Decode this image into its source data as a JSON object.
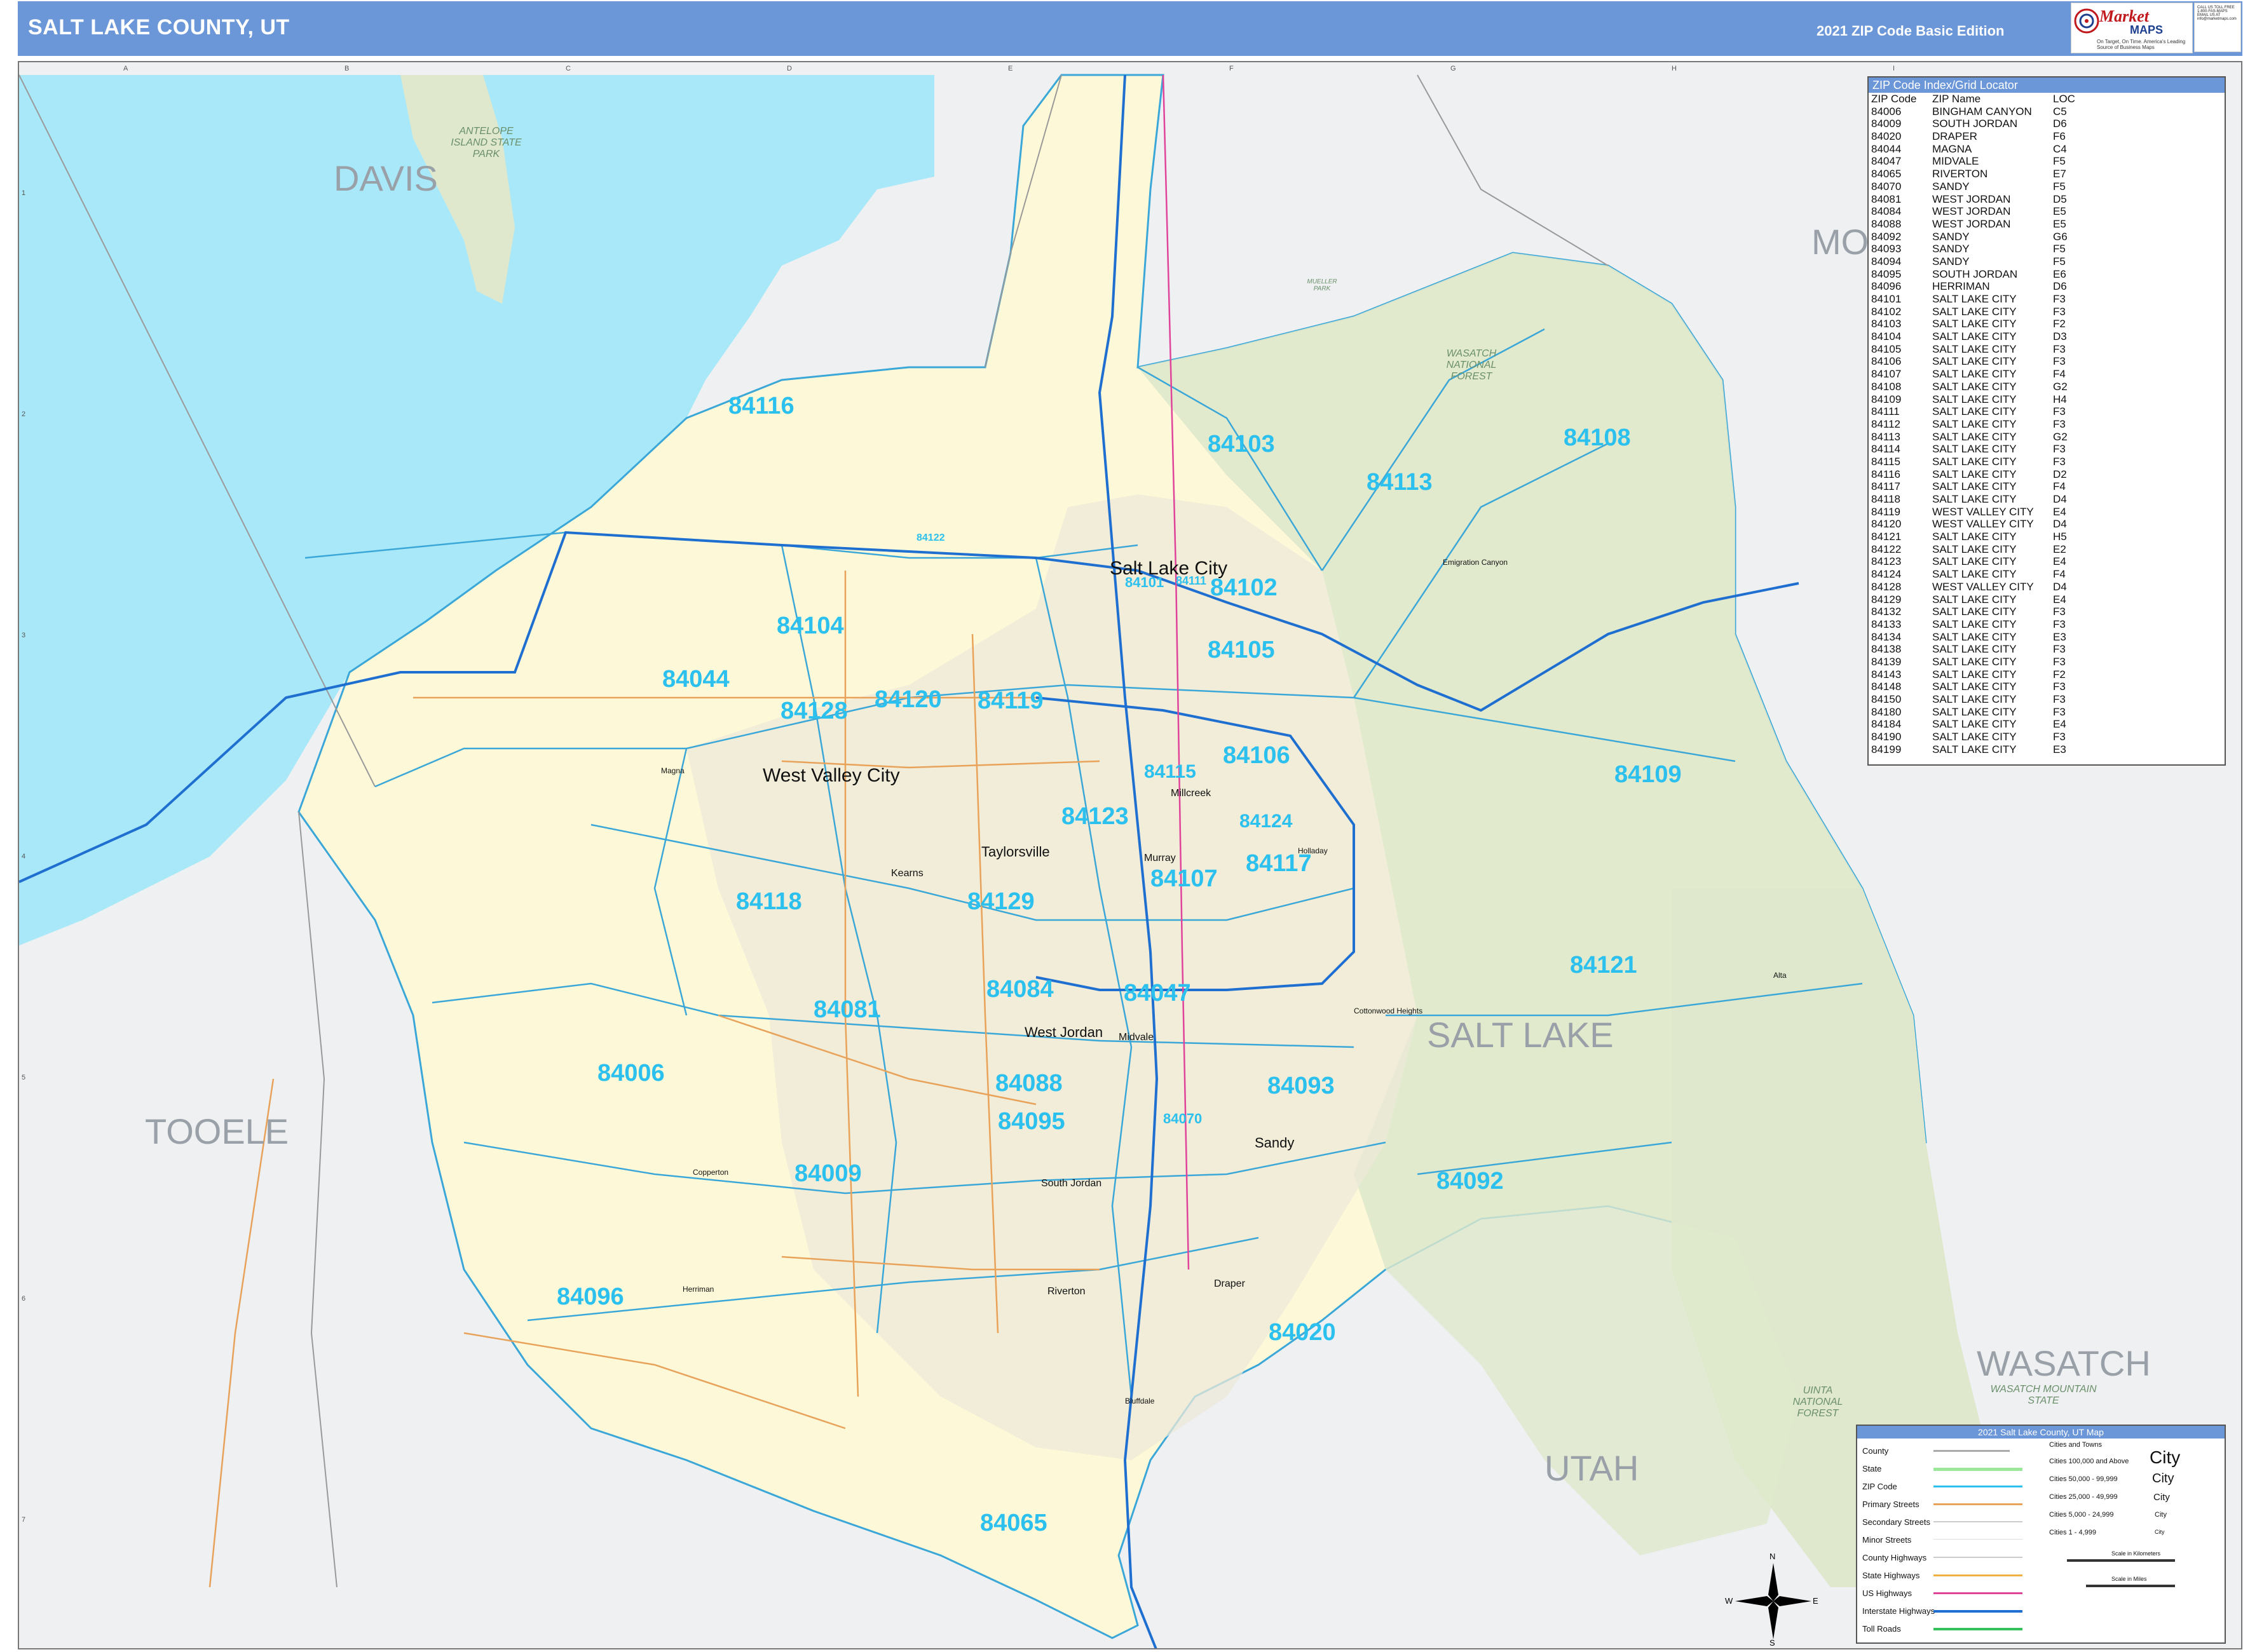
{
  "header": {
    "title": "SALT LAKE COUNTY, UT",
    "edition": "2021 ZIP Code Basic Edition",
    "logo_market": "Market",
    "logo_maps": "MAPS",
    "logo_tagline": "On Target, On Time. America's Leading Source of Business Maps",
    "logo_contact": "CALL US TOLL FREE 1-800-FAS-MAPS EMAIL US AT info@marketmaps.com"
  },
  "grid": {
    "letters": [
      "A",
      "B",
      "C",
      "D",
      "E",
      "F",
      "G",
      "H",
      "I"
    ],
    "numbers": [
      "1",
      "2",
      "3",
      "4",
      "5",
      "6",
      "7"
    ]
  },
  "counties": [
    "DAVIS",
    "MOR",
    "TOOELE",
    "SALT LAKE",
    "UTAH",
    "WASATCH"
  ],
  "parks": {
    "antelope": "ANTELOPE ISLAND STATE PARK",
    "wasatch_nf": "WASATCH NATIONAL FOREST",
    "uinta_nf": "UINTA NATIONAL FOREST",
    "wasatch_mp": "WASATCH MOUNTAIN STATE",
    "mueller": "MUELLER PARK"
  },
  "zips": [
    "84116",
    "84103",
    "84108",
    "84113",
    "84104",
    "84102",
    "84105",
    "84044",
    "84128",
    "84120",
    "84119",
    "84106",
    "84109",
    "84115",
    "84123",
    "84124",
    "84117",
    "84107",
    "84118",
    "84129",
    "84121",
    "84084",
    "84047",
    "84081",
    "84006",
    "84088",
    "84093",
    "84095",
    "84070",
    "84009",
    "84092",
    "84096",
    "84020",
    "84065",
    "84101",
    "84111",
    "84122"
  ],
  "cities": {
    "slc": "Salt Lake City",
    "wvc": "West Valley City",
    "taylorsville": "Taylorsville",
    "kearns": "Kearns",
    "millcreek": "Millcreek",
    "murray": "Murray",
    "west_jordan": "West Jordan",
    "midvale": "Midvale",
    "sandy": "Sandy",
    "south_jordan": "South Jordan",
    "riverton": "Riverton",
    "draper": "Draper",
    "herriman": "Herriman",
    "magna": "Magna",
    "holladay": "Holladay",
    "cottonwood": "Cottonwood Heights",
    "bluffdale": "Bluffdale",
    "copperton": "Copperton",
    "alta": "Alta",
    "emigration": "Emigration Canyon"
  },
  "zip_index": {
    "title": "ZIP Code Index/Grid Locator",
    "headers": [
      "ZIP Code",
      "ZIP Name",
      "LOC"
    ],
    "rows": [
      [
        "84006",
        "BINGHAM CANYON",
        "C5"
      ],
      [
        "84009",
        "SOUTH JORDAN",
        "D6"
      ],
      [
        "84020",
        "DRAPER",
        "F6"
      ],
      [
        "84044",
        "MAGNA",
        "C4"
      ],
      [
        "84047",
        "MIDVALE",
        "F5"
      ],
      [
        "84065",
        "RIVERTON",
        "E7"
      ],
      [
        "84070",
        "SANDY",
        "F5"
      ],
      [
        "84081",
        "WEST JORDAN",
        "D5"
      ],
      [
        "84084",
        "WEST JORDAN",
        "E5"
      ],
      [
        "84088",
        "WEST JORDAN",
        "E5"
      ],
      [
        "84092",
        "SANDY",
        "G6"
      ],
      [
        "84093",
        "SANDY",
        "F5"
      ],
      [
        "84094",
        "SANDY",
        "F5"
      ],
      [
        "84095",
        "SOUTH JORDAN",
        "E6"
      ],
      [
        "84096",
        "HERRIMAN",
        "D6"
      ],
      [
        "84101",
        "SALT LAKE CITY",
        "F3"
      ],
      [
        "84102",
        "SALT LAKE CITY",
        "F3"
      ],
      [
        "84103",
        "SALT LAKE CITY",
        "F2"
      ],
      [
        "84104",
        "SALT LAKE CITY",
        "D3"
      ],
      [
        "84105",
        "SALT LAKE CITY",
        "F3"
      ],
      [
        "84106",
        "SALT LAKE CITY",
        "F3"
      ],
      [
        "84107",
        "SALT LAKE CITY",
        "F4"
      ],
      [
        "84108",
        "SALT LAKE CITY",
        "G2"
      ],
      [
        "84109",
        "SALT LAKE CITY",
        "H4"
      ],
      [
        "84111",
        "SALT LAKE CITY",
        "F3"
      ],
      [
        "84112",
        "SALT LAKE CITY",
        "F3"
      ],
      [
        "84113",
        "SALT LAKE CITY",
        "G2"
      ],
      [
        "84114",
        "SALT LAKE CITY",
        "F3"
      ],
      [
        "84115",
        "SALT LAKE CITY",
        "F3"
      ],
      [
        "84116",
        "SALT LAKE CITY",
        "D2"
      ],
      [
        "84117",
        "SALT LAKE CITY",
        "F4"
      ],
      [
        "84118",
        "SALT LAKE CITY",
        "D4"
      ],
      [
        "84119",
        "WEST VALLEY CITY",
        "E4"
      ],
      [
        "84120",
        "WEST VALLEY CITY",
        "D4"
      ],
      [
        "84121",
        "SALT LAKE CITY",
        "H5"
      ],
      [
        "84122",
        "SALT LAKE CITY",
        "E2"
      ],
      [
        "84123",
        "SALT LAKE CITY",
        "E4"
      ],
      [
        "84124",
        "SALT LAKE CITY",
        "F4"
      ],
      [
        "84128",
        "WEST VALLEY CITY",
        "D4"
      ],
      [
        "84129",
        "SALT LAKE CITY",
        "E4"
      ],
      [
        "84132",
        "SALT LAKE CITY",
        "F3"
      ],
      [
        "84133",
        "SALT LAKE CITY",
        "F3"
      ],
      [
        "84134",
        "SALT LAKE CITY",
        "E3"
      ],
      [
        "84138",
        "SALT LAKE CITY",
        "F3"
      ],
      [
        "84139",
        "SALT LAKE CITY",
        "F3"
      ],
      [
        "84143",
        "SALT LAKE CITY",
        "F2"
      ],
      [
        "84148",
        "SALT LAKE CITY",
        "F3"
      ],
      [
        "84150",
        "SALT LAKE CITY",
        "F3"
      ],
      [
        "84180",
        "SALT LAKE CITY",
        "F3"
      ],
      [
        "84184",
        "SALT LAKE CITY",
        "E4"
      ],
      [
        "84190",
        "SALT LAKE CITY",
        "F3"
      ],
      [
        "84199",
        "SALT LAKE CITY",
        "E3"
      ]
    ]
  },
  "legend": {
    "title": "2021 Salt Lake County, UT Map",
    "items": [
      "County",
      "State",
      "ZIP Code",
      "Primary Streets",
      "Secondary Streets",
      "Minor Streets",
      "County Highways",
      "State Highways",
      "US Highways",
      "Interstate Highways",
      "Toll Roads"
    ],
    "cities_title": "Cities and Towns",
    "city_classes": [
      "Cities 100,000 and Above",
      "Cities 50,000 - 99,999",
      "Cities 25,000 - 49,999",
      "Cities 5,000 - 24,999",
      "Cities 1 - 4,999"
    ],
    "city_sample": "City",
    "scale_km": "Scale in Kilometers",
    "scale_mi": "Scale in Miles",
    "compass": [
      "N",
      "E",
      "S",
      "W"
    ]
  },
  "colors": {
    "header_blue": "#6b97d8",
    "zip_cyan": "#2cc0ee",
    "county_fill": "#fdf9d8",
    "water": "#a8e8f8",
    "forest": "#dfe8cc",
    "outside": "#eef0f2"
  }
}
